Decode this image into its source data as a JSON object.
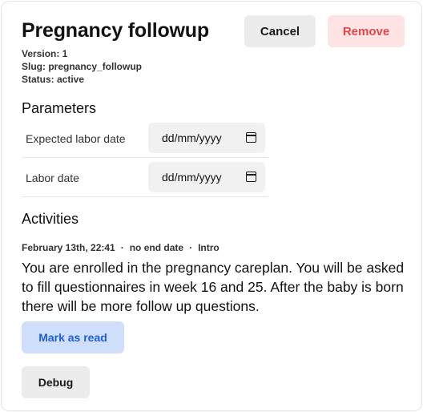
{
  "careplan": {
    "title": "Pregnancy followup",
    "version": "Version: 1",
    "slug": "Slug: pregnancy_followup",
    "status": "Status: active"
  },
  "actions": {
    "cancel_label": "Cancel",
    "remove_label": "Remove",
    "remove_color": "#e0474c"
  },
  "parameters": {
    "heading": "Parameters",
    "items": [
      {
        "label": "Expected labor date",
        "value": "dd/mm/yyyy",
        "icon": "calendar-icon"
      },
      {
        "label": "Labor date",
        "value": "dd/mm/yyyy",
        "icon": "calendar-icon"
      }
    ]
  },
  "activities": {
    "heading": "Activities",
    "items": [
      {
        "date": "February 13th, 22:41",
        "end": "no end date",
        "type": "Intro",
        "separator": "·",
        "text": "You are enrolled in the pregnancy careplan. You will be asked to fill questionnaires in week 16 and 25. After the baby is born there will be more follow up questions.",
        "mark_read_label": "Mark as read",
        "mark_read_color": "#1f5ed8"
      }
    ]
  },
  "footer": {
    "debug_label": "Debug"
  }
}
